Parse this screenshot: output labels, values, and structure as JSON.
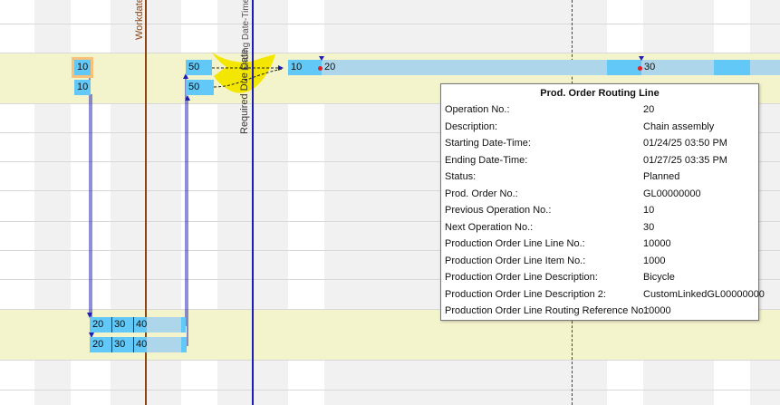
{
  "gantt": {
    "workdate_label": "Workdate",
    "required_due_date_label": "Required Due Date",
    "overlap_label": "Ending Date-Time Start",
    "bars": {
      "top_row_1": {
        "op1": "10",
        "op2": "50",
        "op3": "10",
        "op4": "20",
        "op5": "30"
      },
      "top_row_2": {
        "op1": "10",
        "op2": "50"
      },
      "bottom_row_1": {
        "op1": "20",
        "op2": "30",
        "op3": "40"
      },
      "bottom_row_2": {
        "op1": "20",
        "op2": "30",
        "op3": "40"
      }
    },
    "colors": {
      "bar_strong": "#62c8f7",
      "bar_light": "#aed6ea",
      "band_yellow": "#f4f4cc",
      "workdate_line": "#8b4513",
      "due_date_line": "#1d1db5",
      "selection": "#f8c27a",
      "highlight": "#f3e600"
    }
  },
  "tooltip": {
    "title": "Prod. Order Routing Line",
    "rows": [
      {
        "label": "Operation No.:",
        "value": "20"
      },
      {
        "label": "Description:",
        "value": "Chain assembly"
      },
      {
        "label": "Starting Date-Time:",
        "value": "01/24/25 03:50 PM"
      },
      {
        "label": "Ending Date-Time:",
        "value": "01/27/25 03:35 PM"
      },
      {
        "label": "Status:",
        "value": "Planned"
      },
      {
        "label": "Prod. Order No.:",
        "value": "GL00000000"
      },
      {
        "label": "Previous Operation No.:",
        "value": "10"
      },
      {
        "label": "Next Operation No.:",
        "value": "30"
      },
      {
        "label": "Production Order Line Line No.:",
        "value": "10000"
      },
      {
        "label": "Production Order Line Item No.:",
        "value": "1000"
      },
      {
        "label": "Production Order Line Description:",
        "value": "Bicycle"
      },
      {
        "label": "Production Order Line Description 2:",
        "value": "CustomLinkedGL00000000"
      },
      {
        "label": "Production Order Line Routing Reference No.:",
        "value": "10000"
      }
    ]
  }
}
